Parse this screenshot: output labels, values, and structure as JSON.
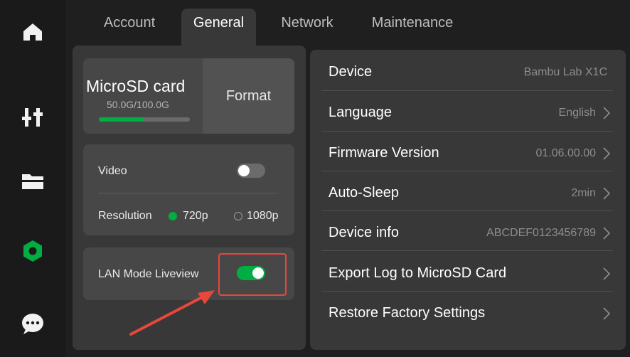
{
  "colors": {
    "accent": "#00ae42",
    "highlight_border": "#e8473b",
    "arrow": "#e8473b"
  },
  "sidebar": {
    "items": [
      {
        "icon": "home-icon"
      },
      {
        "icon": "sliders-icon"
      },
      {
        "icon": "folder-icon"
      },
      {
        "icon": "hexagon-settings-icon",
        "active": true
      },
      {
        "icon": "chat-icon"
      }
    ]
  },
  "tabs": [
    {
      "label": "Account"
    },
    {
      "label": "General",
      "active": true
    },
    {
      "label": "Network"
    },
    {
      "label": "Maintenance"
    }
  ],
  "storage": {
    "title": "MicroSD card",
    "size": "50.0G/100.0G",
    "used_fraction": 0.5,
    "format_label": "Format"
  },
  "video": {
    "label": "Video",
    "enabled": false,
    "resolution_label": "Resolution",
    "options": [
      {
        "label": "720p",
        "selected": true
      },
      {
        "label": "1080p",
        "selected": false
      }
    ]
  },
  "lan": {
    "label": "LAN Mode Liveview",
    "enabled": true
  },
  "settings": [
    {
      "label": "Device",
      "value": "Bambu Lab X1C",
      "chevron": false
    },
    {
      "label": "Language",
      "value": "English",
      "chevron": true
    },
    {
      "label": "Firmware Version",
      "value": "01.06.00.00",
      "chevron": true
    },
    {
      "label": "Auto-Sleep",
      "value": "2min",
      "chevron": true
    },
    {
      "label": "Device info",
      "value": "ABCDEF0123456789",
      "chevron": true
    },
    {
      "label": "Export Log to MicroSD Card",
      "value": "",
      "chevron": true
    },
    {
      "label": "Restore Factory Settings",
      "value": "",
      "chevron": true
    }
  ]
}
